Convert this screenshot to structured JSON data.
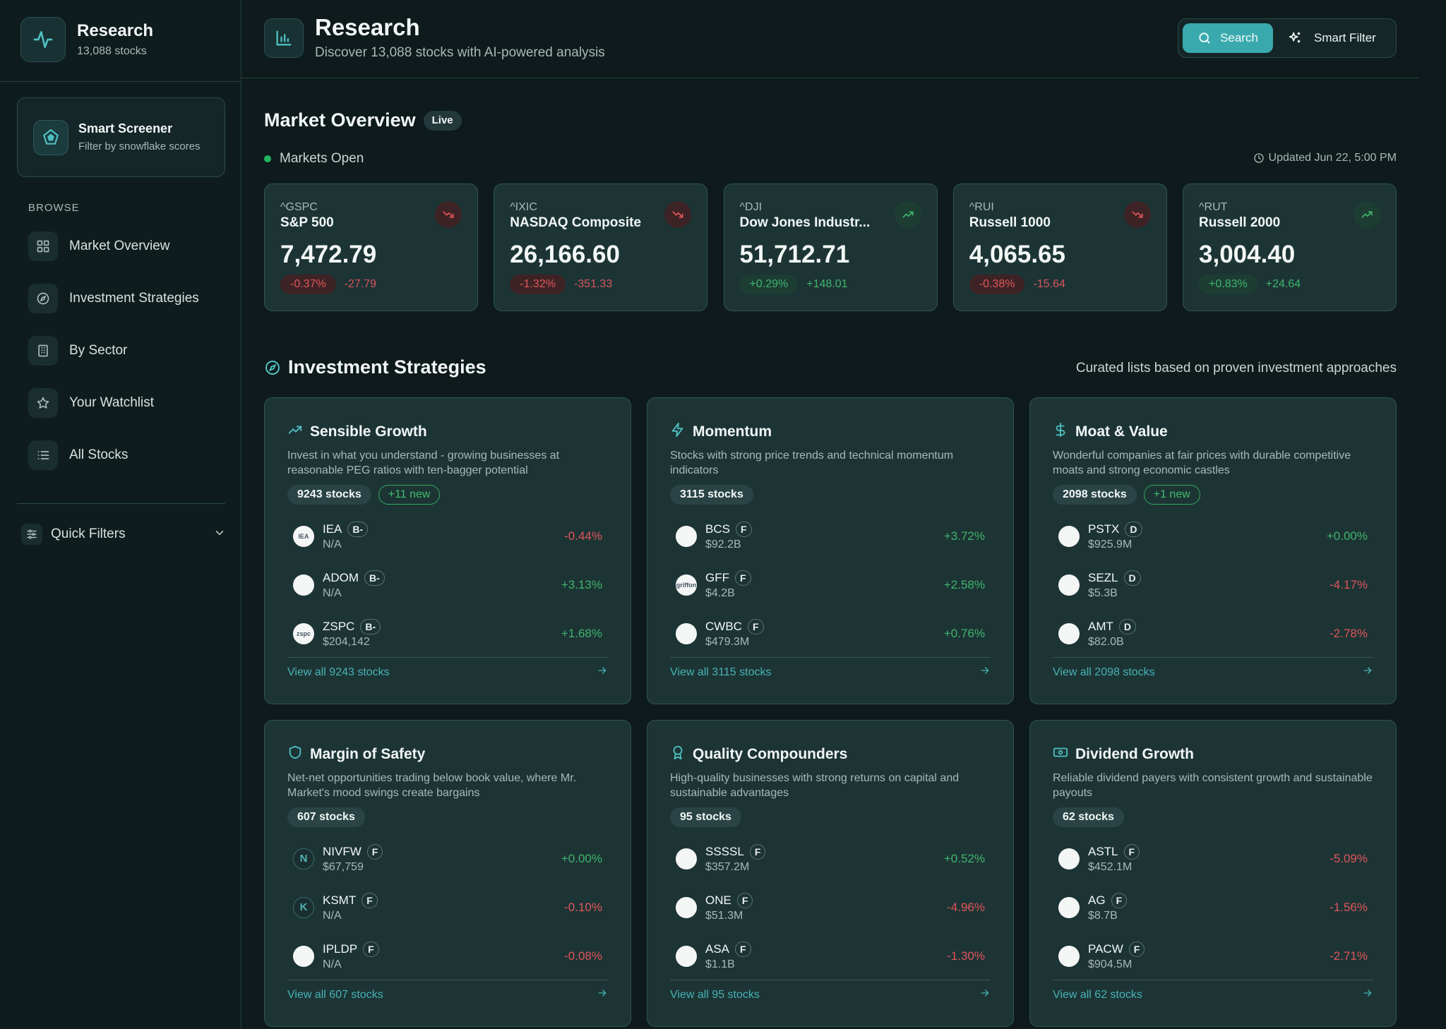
{
  "sidebar": {
    "brand_title": "Research",
    "brand_sub": "13,088 stocks",
    "screener_title": "Smart Screener",
    "screener_sub": "Filter by snowflake scores",
    "browse_label": "BROWSE",
    "items": [
      {
        "label": "Market Overview",
        "icon": "grid-icon"
      },
      {
        "label": "Investment Strategies",
        "icon": "compass-icon"
      },
      {
        "label": "By Sector",
        "icon": "building-icon"
      },
      {
        "label": "Your Watchlist",
        "icon": "star-icon"
      },
      {
        "label": "All Stocks",
        "icon": "list-icon"
      }
    ],
    "quick_filters": "Quick Filters"
  },
  "header": {
    "title": "Research",
    "subtitle": "Discover 13,088 stocks with AI-powered analysis",
    "search_label": "Search",
    "smart_filter_label": "Smart Filter"
  },
  "market": {
    "title": "Market Overview",
    "live": "Live",
    "status": "Markets Open",
    "updated": "Updated Jun 22, 5:00 PM",
    "indices": [
      {
        "symbol": "^GSPC",
        "name": "S&P 500",
        "value": "7,472.79",
        "pct": "-0.37%",
        "abs": "-27.79",
        "dir": "neg"
      },
      {
        "symbol": "^IXIC",
        "name": "NASDAQ Composite",
        "value": "26,166.60",
        "pct": "-1.32%",
        "abs": "-351.33",
        "dir": "neg"
      },
      {
        "symbol": "^DJI",
        "name": "Dow Jones Industr...",
        "value": "51,712.71",
        "pct": "+0.29%",
        "abs": "+148.01",
        "dir": "pos"
      },
      {
        "symbol": "^RUI",
        "name": "Russell 1000",
        "value": "4,065.65",
        "pct": "-0.38%",
        "abs": "-15.64",
        "dir": "neg"
      },
      {
        "symbol": "^RUT",
        "name": "Russell 2000",
        "value": "3,004.40",
        "pct": "+0.83%",
        "abs": "+24.64",
        "dir": "pos"
      }
    ]
  },
  "strategies": {
    "title": "Investment Strategies",
    "subtitle": "Curated lists based on proven investment approaches",
    "cards": [
      {
        "title": "Sensible Growth",
        "icon": "trending-up-icon",
        "desc": "Invest in what you understand - growing businesses at reasonable PEG ratios with ten-bagger potential",
        "count": "9243 stocks",
        "new": "+11 new",
        "footer": "View all 9243 stocks",
        "stocks": [
          {
            "ticker": "IEA",
            "grade": "B-",
            "mcap": "N/A",
            "chg": "-0.44%",
            "dir": "neg",
            "logo": "IEA"
          },
          {
            "ticker": "ADOM",
            "grade": "B-",
            "mcap": "N/A",
            "chg": "+3.13%",
            "dir": "pos",
            "logo": ""
          },
          {
            "ticker": "ZSPC",
            "grade": "B-",
            "mcap": "$204,142",
            "chg": "+1.68%",
            "dir": "pos",
            "logo": "zspc"
          }
        ]
      },
      {
        "title": "Momentum",
        "icon": "lightning-icon",
        "desc": "Stocks with strong price trends and technical momentum indicators",
        "count": "3115 stocks",
        "new": "",
        "footer": "View all 3115 stocks",
        "stocks": [
          {
            "ticker": "BCS",
            "grade": "F",
            "mcap": "$92.2B",
            "chg": "+3.72%",
            "dir": "pos",
            "logo": ""
          },
          {
            "ticker": "GFF",
            "grade": "F",
            "mcap": "$4.2B",
            "chg": "+2.58%",
            "dir": "pos",
            "logo": "griffon"
          },
          {
            "ticker": "CWBC",
            "grade": "F",
            "mcap": "$479.3M",
            "chg": "+0.76%",
            "dir": "pos",
            "logo": ""
          }
        ]
      },
      {
        "title": "Moat & Value",
        "icon": "dollar-icon",
        "desc": "Wonderful companies at fair prices with durable competitive moats and strong economic castles",
        "count": "2098 stocks",
        "new": "+1 new",
        "footer": "View all 2098 stocks",
        "stocks": [
          {
            "ticker": "PSTX",
            "grade": "D",
            "mcap": "$925.9M",
            "chg": "+0.00%",
            "dir": "pos",
            "logo": ""
          },
          {
            "ticker": "SEZL",
            "grade": "D",
            "mcap": "$5.3B",
            "chg": "-4.17%",
            "dir": "neg",
            "logo": ""
          },
          {
            "ticker": "AMT",
            "grade": "D",
            "mcap": "$82.0B",
            "chg": "-2.78%",
            "dir": "neg",
            "logo": ""
          }
        ]
      },
      {
        "title": "Margin of Safety",
        "icon": "shield-icon",
        "desc": "Net-net opportunities trading below book value, where Mr. Market's mood swings create bargains",
        "count": "607 stocks",
        "new": "",
        "footer": "View all 607 stocks",
        "stocks": [
          {
            "ticker": "NIVFW",
            "grade": "F",
            "mcap": "$67,759",
            "chg": "+0.00%",
            "dir": "pos",
            "logo": "N"
          },
          {
            "ticker": "KSMT",
            "grade": "F",
            "mcap": "N/A",
            "chg": "-0.10%",
            "dir": "neg",
            "logo": "K"
          },
          {
            "ticker": "IPLDP",
            "grade": "F",
            "mcap": "N/A",
            "chg": "-0.08%",
            "dir": "neg",
            "logo": ""
          }
        ]
      },
      {
        "title": "Quality Compounders",
        "icon": "award-icon",
        "desc": "High-quality businesses with strong returns on capital and sustainable advantages",
        "count": "95 stocks",
        "new": "",
        "footer": "View all 95 stocks",
        "stocks": [
          {
            "ticker": "SSSSL",
            "grade": "F",
            "mcap": "$357.2M",
            "chg": "+0.52%",
            "dir": "pos",
            "logo": ""
          },
          {
            "ticker": "ONE",
            "grade": "F",
            "mcap": "$51.3M",
            "chg": "-4.96%",
            "dir": "neg",
            "logo": ""
          },
          {
            "ticker": "ASA",
            "grade": "F",
            "mcap": "$1.1B",
            "chg": "-1.30%",
            "dir": "neg",
            "logo": ""
          }
        ]
      },
      {
        "title": "Dividend Growth",
        "icon": "banknote-icon",
        "desc": "Reliable dividend payers with consistent growth and sustainable payouts",
        "count": "62 stocks",
        "new": "",
        "footer": "View all 62 stocks",
        "stocks": [
          {
            "ticker": "ASTL",
            "grade": "F",
            "mcap": "$452.1M",
            "chg": "-5.09%",
            "dir": "neg",
            "logo": ""
          },
          {
            "ticker": "AG",
            "grade": "F",
            "mcap": "$8.7B",
            "chg": "-1.56%",
            "dir": "neg",
            "logo": ""
          },
          {
            "ticker": "PACW",
            "grade": "F",
            "mcap": "$904.5M",
            "chg": "-2.71%",
            "dir": "neg",
            "logo": ""
          }
        ]
      }
    ]
  },
  "colors": {
    "background": "#0e1a1b",
    "card": "#1d3435",
    "accent": "#3aa9ad",
    "positive": "#3fb56c",
    "negative": "#e0555a"
  }
}
